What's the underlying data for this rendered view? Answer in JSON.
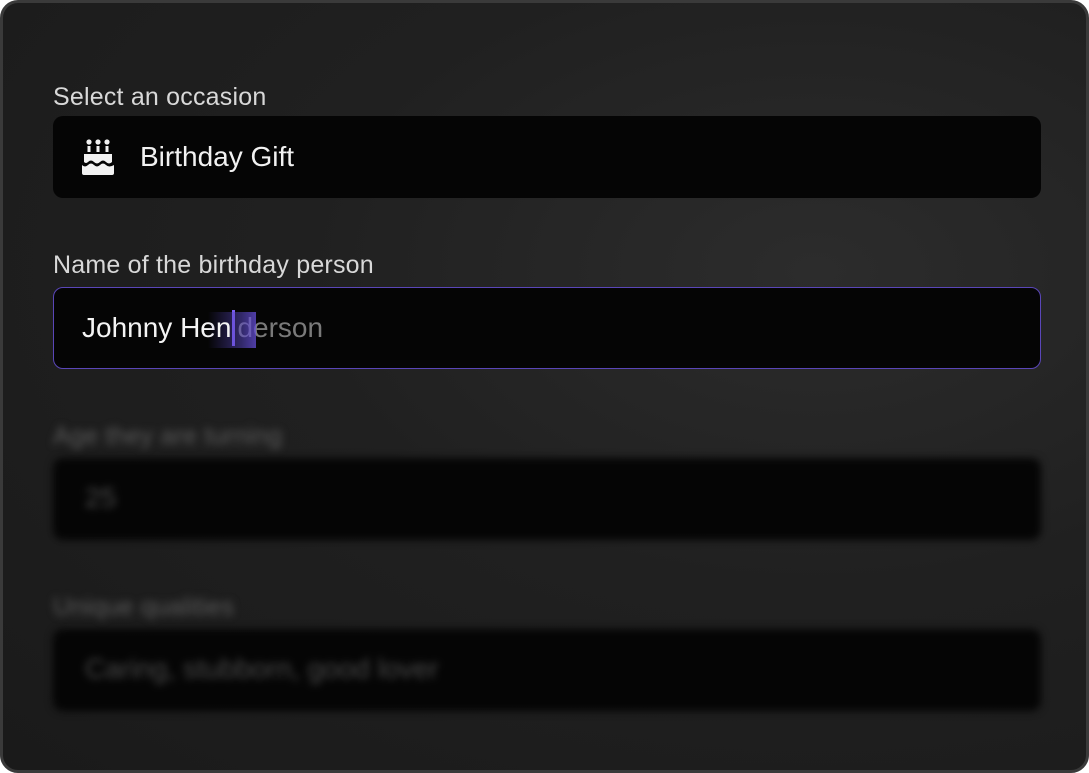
{
  "occasion": {
    "label": "Select an occasion",
    "icon": "birthday-cake-icon",
    "value": "Birthday Gift"
  },
  "name": {
    "label": "Name of the birthday person",
    "typed_prefix": "Johnny He",
    "typed_last": "n",
    "suggestion": "derson",
    "accent_color": "#5a46b8"
  },
  "age": {
    "label": "Age they are turning",
    "value": "25"
  },
  "qualities": {
    "label": "Unique qualities",
    "value": "Caring, stubborn, good lover"
  }
}
